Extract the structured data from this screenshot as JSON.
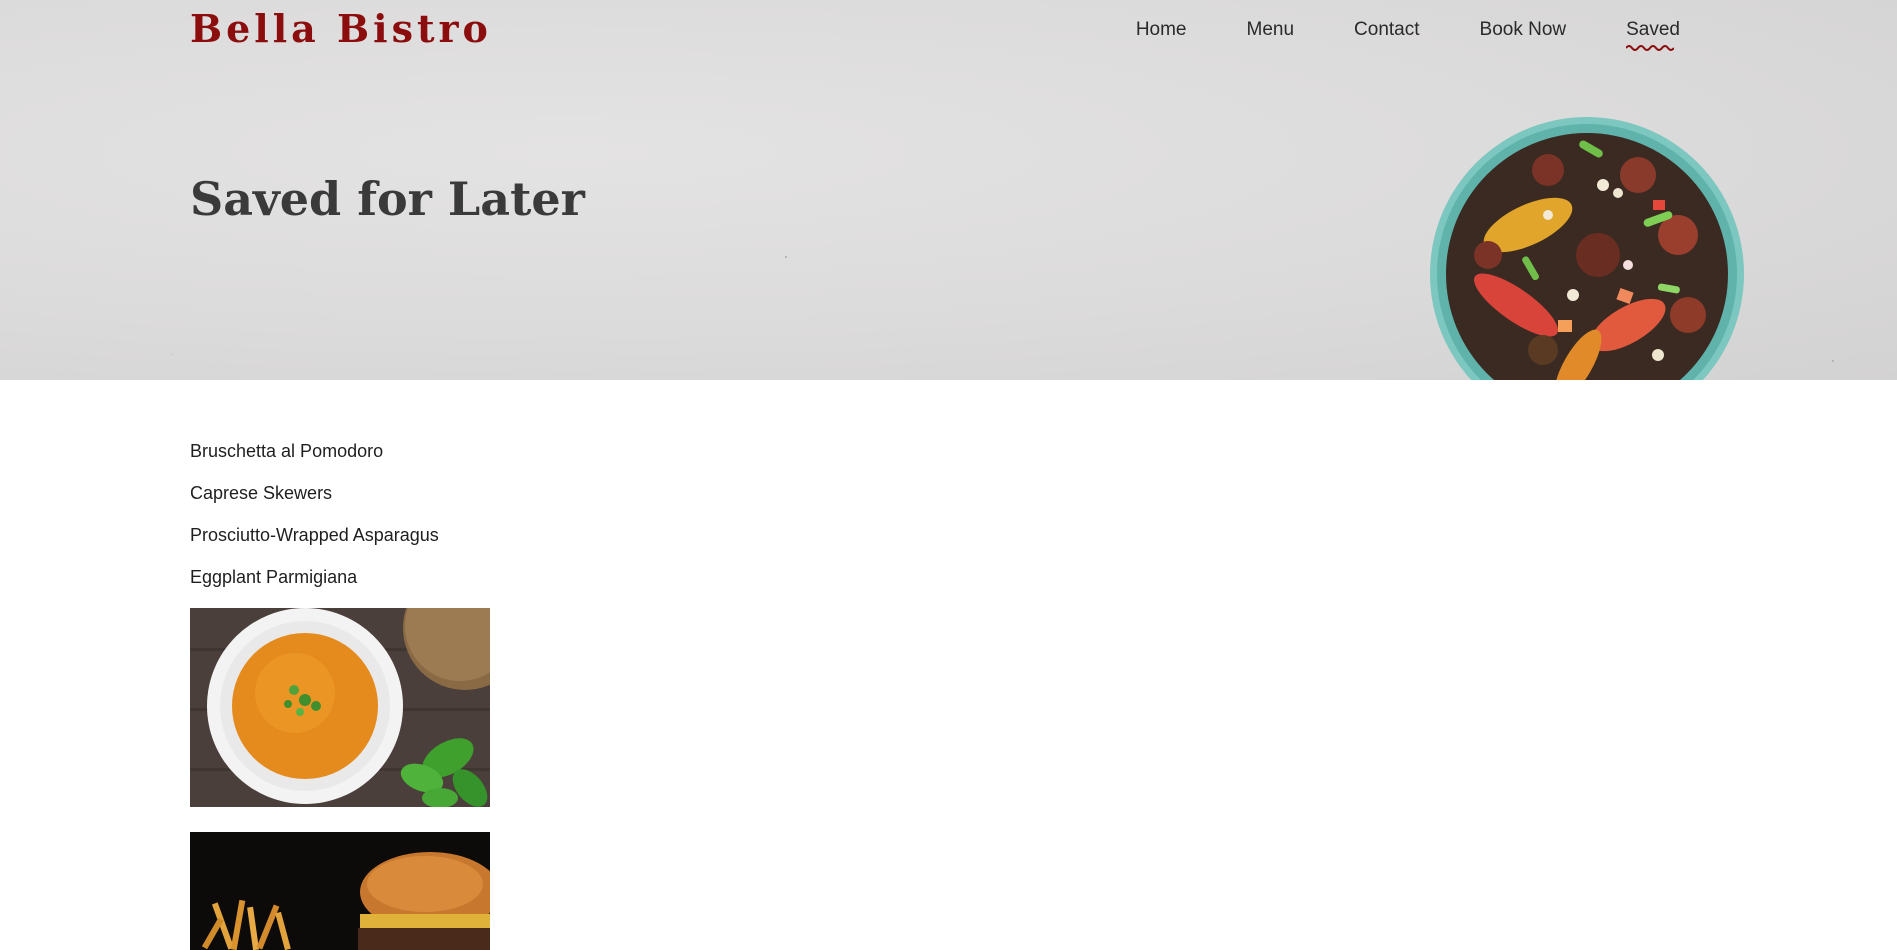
{
  "brand": {
    "name": "Bella Bistro",
    "color": "#8b0d0d"
  },
  "nav": {
    "items": [
      {
        "label": "Home"
      },
      {
        "label": "Menu"
      },
      {
        "label": "Contact"
      },
      {
        "label": "Book Now"
      },
      {
        "label": "Saved",
        "active": true
      }
    ],
    "active_underline_color": "#8b0d0d"
  },
  "hero": {
    "title": "Saved for Later",
    "image": "bowl-of-roasted-vegetables"
  },
  "saved_items": [
    {
      "label": "Bruschetta al Pomodoro"
    },
    {
      "label": "Caprese Skewers"
    },
    {
      "label": "Prosciutto-Wrapped Asparagus"
    },
    {
      "label": "Eggplant Parmigiana"
    }
  ],
  "saved_images": [
    {
      "name": "tomato-soup-with-basil"
    },
    {
      "name": "burger-with-fries"
    }
  ]
}
